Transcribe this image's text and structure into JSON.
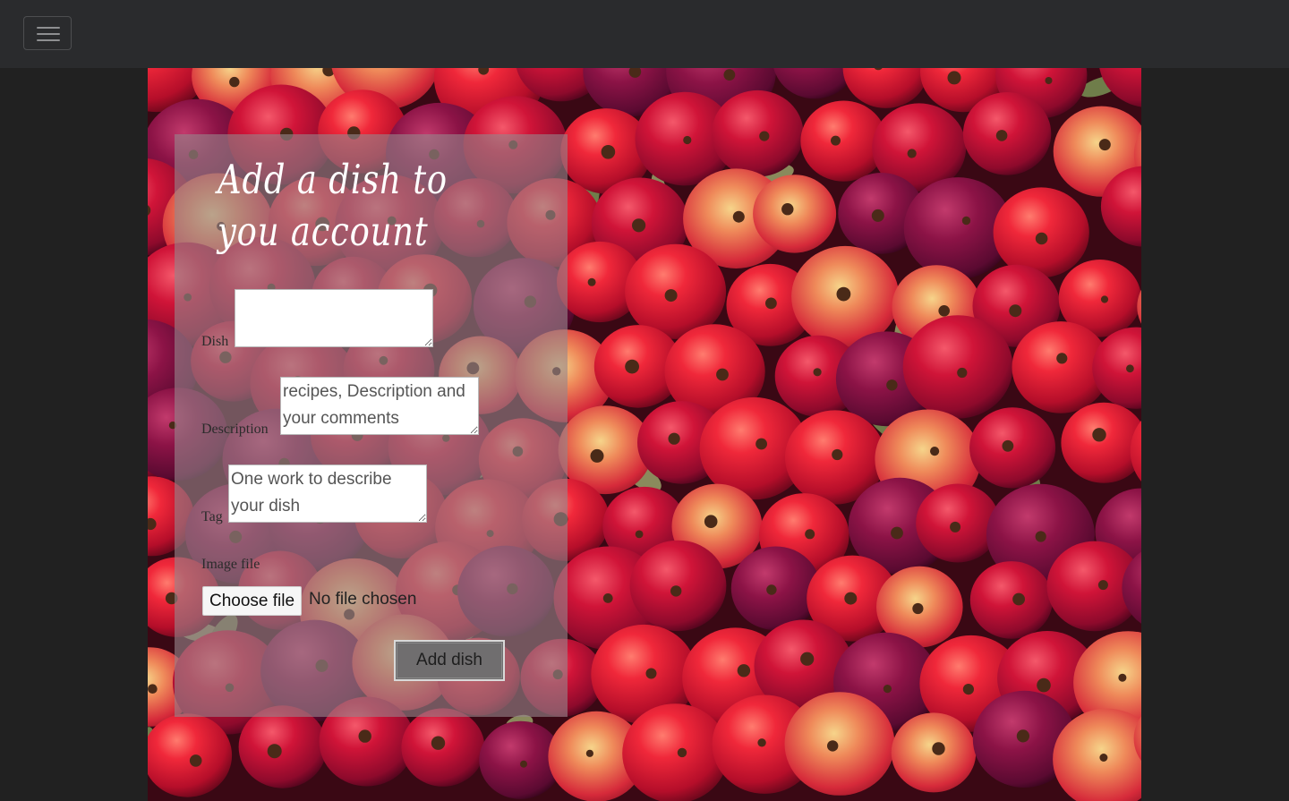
{
  "navbar": {
    "toggle_icon": "hamburger-menu-icon"
  },
  "hero": {
    "background": "red-apples-photo",
    "accent": "#c8102e"
  },
  "form": {
    "title": "Add a dish to you account",
    "dish": {
      "label": "Dish",
      "value": "",
      "placeholder": ""
    },
    "description": {
      "label": "Description",
      "placeholder": "recipes, Description and your comments"
    },
    "tag": {
      "label": "Tag",
      "placeholder": "One work to describe your dish"
    },
    "image": {
      "label": "Image file",
      "button_label": "Choose file",
      "status": "No file chosen"
    },
    "submit_label": "Add dish"
  }
}
